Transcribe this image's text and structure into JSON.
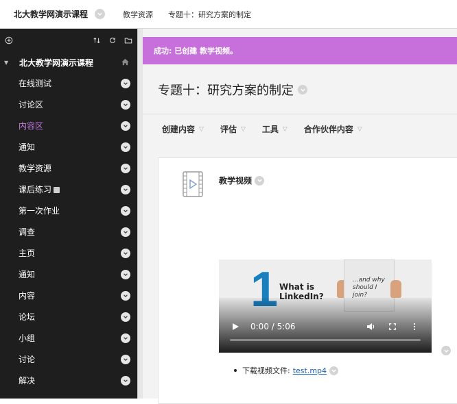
{
  "header": {
    "course_name": "北大教学网演示课程",
    "breadcrumbs": [
      "教学资源",
      "专题十：研究方案的制定"
    ]
  },
  "sidebar": {
    "course_title": "北大教学网演示课程",
    "items": [
      {
        "label": "在线测试"
      },
      {
        "label": "讨论区"
      },
      {
        "label": "内容区",
        "active": true
      },
      {
        "label": "通知"
      },
      {
        "label": "教学资源"
      },
      {
        "label": "课后练习"
      },
      {
        "label": "第一次作业"
      },
      {
        "label": "调查"
      },
      {
        "label": "主页"
      },
      {
        "label": "通知"
      },
      {
        "label": "内容"
      },
      {
        "label": "论坛"
      },
      {
        "label": "小组"
      },
      {
        "label": "讨论"
      },
      {
        "label": "解决"
      }
    ]
  },
  "main": {
    "success_message": "成功: 已创建 教学视频。",
    "page_title": "专题十：研究方案的制定",
    "actions": [
      "创建内容",
      "评估",
      "工具",
      "合作伙伴内容"
    ],
    "item": {
      "title": "教学视频",
      "video": {
        "big_number": "1",
        "headline_line1": "What is",
        "headline_line2": "LinkedIn?",
        "sign_line1": "...and why",
        "sign_line2": "should I",
        "sign_line3": "join?",
        "time": "0:00 / 5:06",
        "progress": 0
      },
      "download_label": "下载视频文件:",
      "download_file": "test.mp4"
    }
  },
  "colors": {
    "sidebar_bg": "#1e1e1e",
    "accent_purple": "#c76fda",
    "active_item": "#c77de0",
    "link": "#1a5fb0",
    "linkedin_blue": "#1a7fbf"
  }
}
